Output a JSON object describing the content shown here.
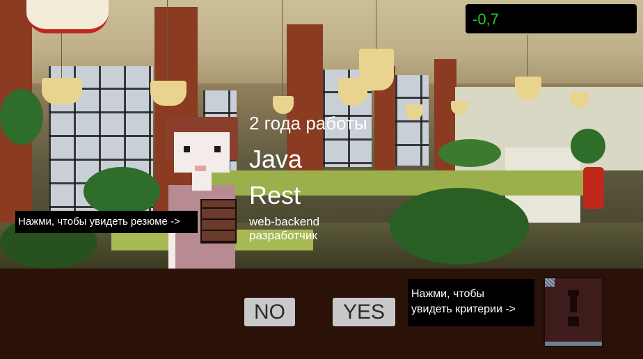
{
  "hud": {
    "score": "-0,7"
  },
  "candidate": {
    "experience": "2 года работы",
    "language": "Java",
    "api_style": "Rest",
    "role_line1": "web-backend",
    "role_line2": "разработчик"
  },
  "hints": {
    "resume": "Нажми, чтобы увидеть резюме ->",
    "criteria_line1": "Нажми, чтобы",
    "criteria_line2": "увидеть критерии ->"
  },
  "buttons": {
    "no": "NO",
    "yes": "YES"
  },
  "colors": {
    "score_text": "#25c62b",
    "panel_bg": "#2a1208",
    "button_bg": "#c9c9c9"
  }
}
